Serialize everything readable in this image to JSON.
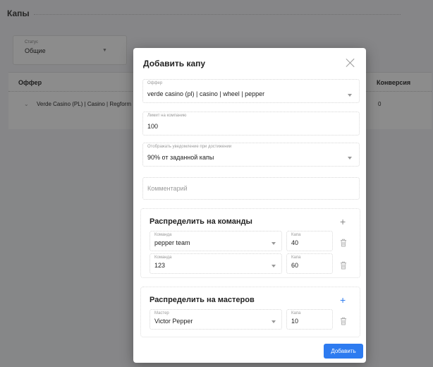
{
  "background": {
    "page_title": "Капы",
    "filter": {
      "label": "Статус",
      "value": "Общие"
    },
    "table": {
      "headers": {
        "offer": "Оффер",
        "conversion": "Конверсия"
      },
      "row": {
        "offer": "Verde Casino (PL) | Casino | Regform",
        "conversion": "0"
      }
    }
  },
  "modal": {
    "title": "Добавить капу",
    "offer": {
      "label": "Оффер",
      "value": "verde casino (pl) | casino | wheel | pepper"
    },
    "limit": {
      "label": "Лимит на компанию",
      "value": "100"
    },
    "notify": {
      "label": "Отображать уведомление при достижении",
      "value": "90% от заданной капы"
    },
    "comment": {
      "placeholder": "Комментарий"
    },
    "teams_section": {
      "title": "Распределить на команды",
      "rows": [
        {
          "team_label": "Команда",
          "team_value": "pepper team",
          "cap_label": "Капа",
          "cap_value": "40"
        },
        {
          "team_label": "Команда",
          "team_value": "123",
          "cap_label": "Капа",
          "cap_value": "60"
        }
      ]
    },
    "masters_section": {
      "title": "Распределить на мастеров",
      "rows": [
        {
          "master_label": "Мастер",
          "master_value": "Victor Pepper",
          "cap_label": "Капа",
          "cap_value": "10"
        }
      ]
    },
    "submit_label": "Добавить"
  },
  "icons": {
    "close": "close-icon",
    "add": "plus-icon",
    "delete": "trash-icon",
    "dropdown": "chevron-down-icon"
  },
  "colors": {
    "primary": "#2d7bf0",
    "overlay": "rgba(0,0,0,0.45)",
    "plus_gray": "#888888"
  }
}
